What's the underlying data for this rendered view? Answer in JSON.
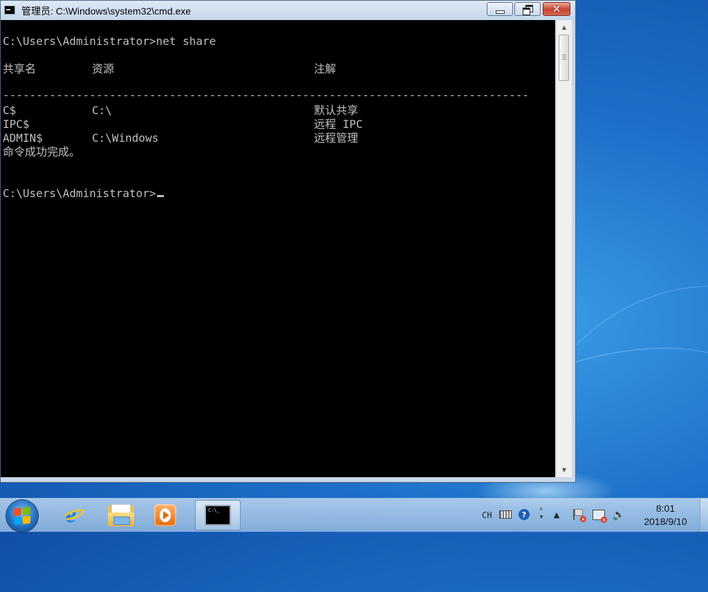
{
  "window": {
    "title": "管理员: C:\\Windows\\system32\\cmd.exe",
    "close_label": "✕"
  },
  "console": {
    "prompt1": "C:\\Users\\Administrator>net share",
    "headers": {
      "share_name": "共享名",
      "resource": "资源",
      "remark": "注解"
    },
    "dashes": "-------------------------------------------------------------------------------",
    "rows": [
      {
        "name": "C$",
        "resource": "C:\\",
        "remark": "默认共享"
      },
      {
        "name": "IPC$",
        "resource": "",
        "remark": "远程 IPC"
      },
      {
        "name": "ADMIN$",
        "resource": "C:\\Windows",
        "remark": "远程管理"
      }
    ],
    "result": "命令成功完成。",
    "prompt2": "C:\\Users\\Administrator>"
  },
  "taskbar": {
    "ime_label": "CH",
    "time": "8:01",
    "date": "2018/9/10",
    "cmd_icon_text": "C:\\_",
    "help_glyph": "?",
    "tray_arrow": "▲",
    "volume_glyph": "🔈"
  },
  "colors": {
    "console_bg": "#000000",
    "console_text": "#c0c0c0",
    "desktop_blue": "#1e6fc8"
  }
}
